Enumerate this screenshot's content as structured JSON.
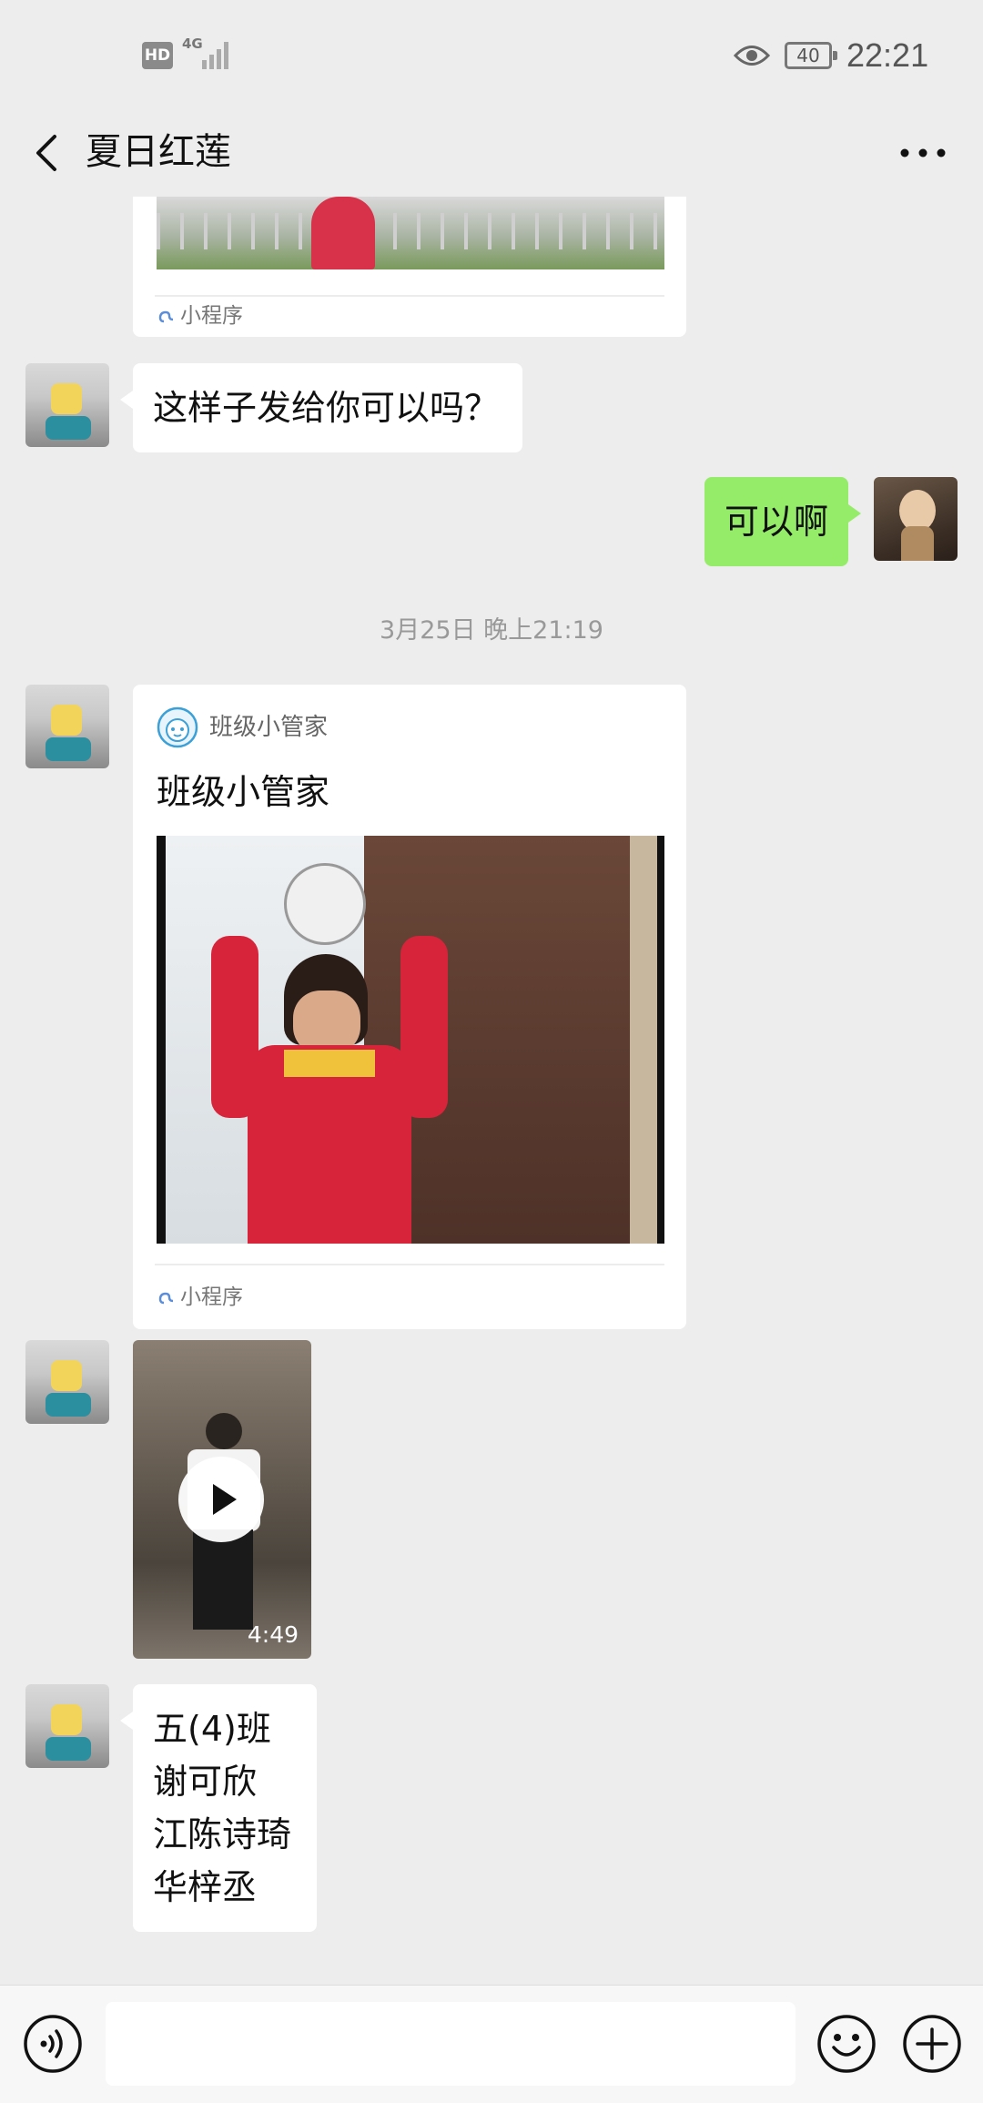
{
  "status_bar": {
    "hd": "HD",
    "network": "4G",
    "battery": "40",
    "time": "22:21"
  },
  "nav": {
    "title": "夏日红莲",
    "back_icon": "chevron-left-icon",
    "more_icon": "more-dots-icon"
  },
  "messages": {
    "card1_footer": "小程序",
    "msg_question": "这样子发给你可以吗？",
    "msg_reply": "可以啊",
    "timestamp_1": "3月25日 晚上21:19",
    "card2": {
      "app_name": "班级小管家",
      "title": "班级小管家",
      "footer": "小程序"
    },
    "video_duration": "4:49",
    "names_message": [
      "五(4)班",
      "谢可欣",
      "江陈诗琦",
      "华梓丞"
    ]
  },
  "input": {
    "placeholder": ""
  },
  "colors": {
    "background": "#EDEDED",
    "self_bubble": "#95EC69",
    "other_bubble": "#FFFFFF",
    "timestamp_text": "#999999"
  }
}
